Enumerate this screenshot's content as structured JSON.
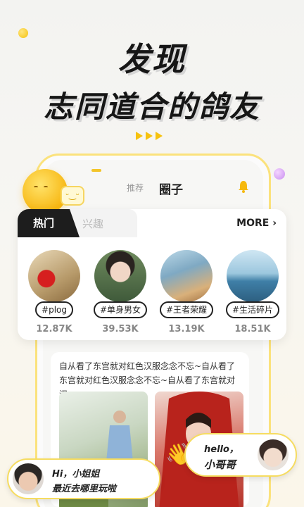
{
  "headline": {
    "line1": "发现",
    "line2": "志同道合的鸽友"
  },
  "top_nav": {
    "recommend": "推荐",
    "circle": "圈子"
  },
  "hot_card": {
    "tab_hot": "热门",
    "tab_interest": "兴趣",
    "more": "MORE",
    "topics": [
      {
        "tag": "#plog",
        "count": "12.87K"
      },
      {
        "tag": "#单身男女",
        "count": "39.53K"
      },
      {
        "tag": "#王者荣耀",
        "count": "13.19K"
      },
      {
        "tag": "#生活碎片",
        "count": "18.51K"
      }
    ]
  },
  "feed": {
    "text": "自从看了东宫就对红色汉服念念不忘~自从看了东宫就对红色汉服念念不忘~自从看了东宫就对汉"
  },
  "chat_left": {
    "line1": "Hi，小姐姐",
    "line2": "最近去哪里玩啦"
  },
  "chat_right": {
    "line1": "hello，",
    "line2": "小哥哥"
  },
  "colors": {
    "accent_yellow": "#f6c20f",
    "dark": "#1d1d1d"
  },
  "icons": [
    "bell-icon",
    "chevron-right-icon",
    "mascot-icon",
    "wave-hand-icon"
  ]
}
